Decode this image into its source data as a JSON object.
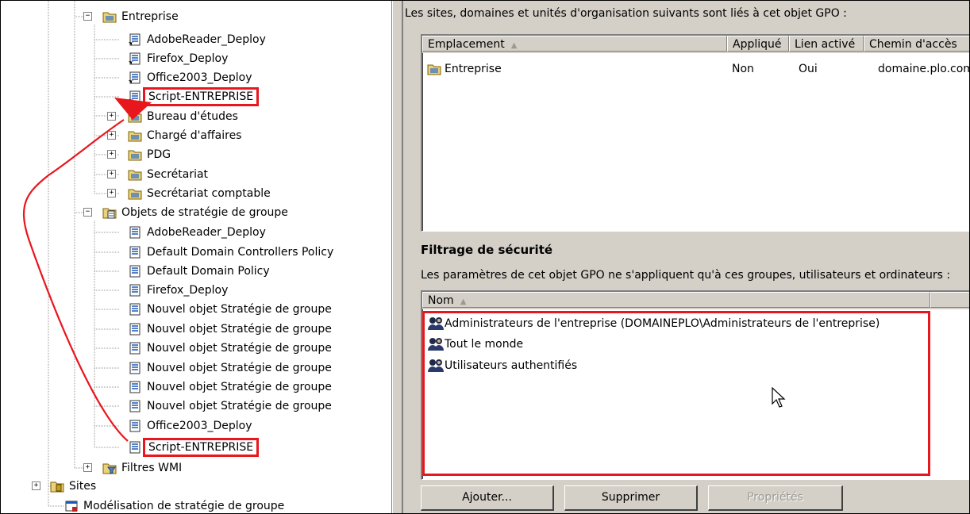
{
  "tree": {
    "items": [
      {
        "label": "Entreprise",
        "icon": "ou-folder-icon",
        "expander": "−"
      },
      {
        "label": "AdobeReader_Deploy",
        "icon": "gpo-link-icon"
      },
      {
        "label": "Firefox_Deploy",
        "icon": "gpo-link-icon"
      },
      {
        "label": "Office2003_Deploy",
        "icon": "gpo-link-icon"
      },
      {
        "label": "Script-ENTREPRISE",
        "icon": "gpo-link-icon"
      },
      {
        "label": "Bureau d'études",
        "icon": "ou-folder-icon",
        "expander": "+"
      },
      {
        "label": "Chargé d'affaires",
        "icon": "ou-folder-icon",
        "expander": "+"
      },
      {
        "label": "PDG",
        "icon": "ou-folder-icon",
        "expander": "+"
      },
      {
        "label": "Secrétariat",
        "icon": "ou-folder-icon",
        "expander": "+"
      },
      {
        "label": "Secrétariat comptable",
        "icon": "ou-folder-icon",
        "expander": "+"
      },
      {
        "label": "Objets de stratégie de groupe",
        "icon": "gpo-container-icon",
        "expander": "−"
      },
      {
        "label": "AdobeReader_Deploy",
        "icon": "gpo-icon"
      },
      {
        "label": "Default Domain Controllers Policy",
        "icon": "gpo-icon"
      },
      {
        "label": "Default Domain Policy",
        "icon": "gpo-icon"
      },
      {
        "label": "Firefox_Deploy",
        "icon": "gpo-icon"
      },
      {
        "label": "Nouvel objet Stratégie de groupe",
        "icon": "gpo-icon"
      },
      {
        "label": "Nouvel objet Stratégie de groupe",
        "icon": "gpo-icon"
      },
      {
        "label": "Nouvel objet Stratégie de groupe",
        "icon": "gpo-icon"
      },
      {
        "label": "Nouvel objet Stratégie de groupe",
        "icon": "gpo-icon"
      },
      {
        "label": "Nouvel objet Stratégie de groupe",
        "icon": "gpo-icon"
      },
      {
        "label": "Nouvel objet Stratégie de groupe",
        "icon": "gpo-icon"
      },
      {
        "label": "Office2003_Deploy",
        "icon": "gpo-icon"
      },
      {
        "label": "Script-ENTREPRISE",
        "icon": "gpo-icon"
      },
      {
        "label": "Filtres WMI",
        "icon": "wmi-filter-icon",
        "expander": "+"
      },
      {
        "label": "Sites",
        "icon": "sites-icon",
        "expander": "+"
      },
      {
        "label": "Modélisation de stratégie de groupe",
        "icon": "modeling-icon"
      }
    ]
  },
  "links": {
    "caption": "Les sites, domaines et unités d'organisation suivants sont liés à cet objet GPO :",
    "columns": [
      "Emplacement",
      "Appliqué",
      "Lien activé",
      "Chemin d'accès"
    ],
    "rows": [
      {
        "location": "Entreprise",
        "applied": "Non",
        "enabled": "Oui",
        "path": "domaine.plo.com"
      }
    ]
  },
  "security": {
    "title": "Filtrage de sécurité",
    "caption": "Les paramètres de cet objet GPO ne s'appliquent qu'à ces groupes, utilisateurs et ordinateurs :",
    "columns": [
      "Nom"
    ],
    "rows": [
      "Administrateurs de l'entreprise (DOMAINEPLO\\Administrateurs de l'entreprise)",
      "Tout le monde",
      "Utilisateurs authentifiés"
    ]
  },
  "buttons": {
    "add": "Ajouter...",
    "remove": "Supprimer",
    "properties": "Propriétés"
  },
  "colors": {
    "highlight": "#e8161d",
    "dialog_bg": "#d4d0c8"
  }
}
